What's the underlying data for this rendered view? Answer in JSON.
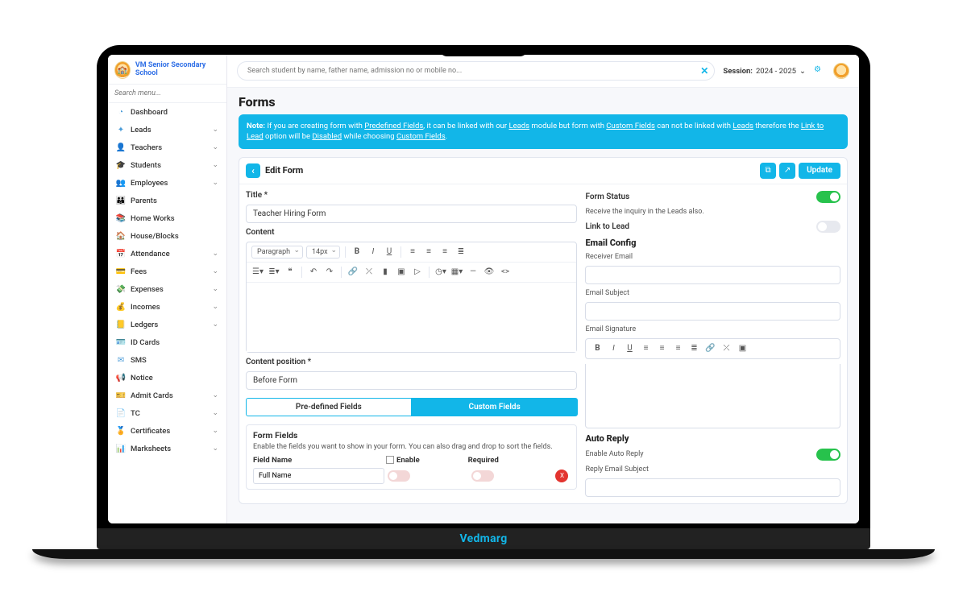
{
  "brand": {
    "name": "VM Senior Secondary School"
  },
  "searchMenuPlaceholder": "Search menu...",
  "menu": [
    {
      "icon": "◔",
      "label": "Dashboard",
      "expandable": false
    },
    {
      "icon": "✦",
      "label": "Leads",
      "expandable": true
    },
    {
      "icon": "👤",
      "label": "Teachers",
      "expandable": true
    },
    {
      "icon": "🎓",
      "label": "Students",
      "expandable": true
    },
    {
      "icon": "👥",
      "label": "Employees",
      "expandable": true
    },
    {
      "icon": "👪",
      "label": "Parents",
      "expandable": false
    },
    {
      "icon": "📚",
      "label": "Home Works",
      "expandable": false
    },
    {
      "icon": "🏠",
      "label": "House/Blocks",
      "expandable": false
    },
    {
      "icon": "📅",
      "label": "Attendance",
      "expandable": true
    },
    {
      "icon": "💳",
      "label": "Fees",
      "expandable": true
    },
    {
      "icon": "💸",
      "label": "Expenses",
      "expandable": true
    },
    {
      "icon": "💰",
      "label": "Incomes",
      "expandable": true
    },
    {
      "icon": "📒",
      "label": "Ledgers",
      "expandable": true
    },
    {
      "icon": "🪪",
      "label": "ID Cards",
      "expandable": false
    },
    {
      "icon": "✉",
      "label": "SMS",
      "expandable": false
    },
    {
      "icon": "📢",
      "label": "Notice",
      "expandable": false
    },
    {
      "icon": "🎫",
      "label": "Admit Cards",
      "expandable": true
    },
    {
      "icon": "📄",
      "label": "TC",
      "expandable": true
    },
    {
      "icon": "🏅",
      "label": "Certificates",
      "expandable": true
    },
    {
      "icon": "📊",
      "label": "Marksheets",
      "expandable": true
    }
  ],
  "topbar": {
    "searchPlaceholder": "Search student by name, father name, admission no or mobile no...",
    "sessionLabel": "Session:",
    "sessionValue": "2024 - 2025"
  },
  "page": {
    "title": "Forms"
  },
  "note": {
    "prefix": "Note:",
    "t1": "If you are creating form with",
    "predefined": "Predefined Fields",
    "t2": ", it can be linked with our",
    "leads1": "Leads",
    "t3": "module but form with",
    "custom1": "Custom Fields",
    "t4": "can not be linked with",
    "leads2": "Leads",
    "t5": "therefore the",
    "linkToLead": "Link to Lead",
    "t6": "option will be",
    "disabled": "Disabled",
    "t7": "while choosing",
    "custom2": "Custom Fields",
    "dot": "."
  },
  "card": {
    "title": "Edit Form",
    "updateLabel": "Update",
    "left": {
      "titleLabel": "Title *",
      "titleValue": "Teacher Hiring Form",
      "contentLabel": "Content",
      "paragraphSelect": "Paragraph",
      "fontSizeSelect": "14px",
      "contentPositionLabel": "Content position *",
      "contentPositionValue": "Before Form",
      "tabPredefined": "Pre-defined Fields",
      "tabCustom": "Custom Fields",
      "formFieldsTitle": "Form Fields",
      "formFieldsDesc": "Enable the fields you want to show in your form. You can also drag and drop to sort the fields.",
      "colFieldName": "Field Name",
      "colEnable": "Enable",
      "colRequired": "Required",
      "row1Name": "Full Name",
      "deleteSymbol": "X"
    },
    "right": {
      "formStatusLabel": "Form Status",
      "receiveText": "Receive the inquiry in the Leads also.",
      "linkToLeadLabel": "Link to Lead",
      "emailConfigTitle": "Email Config",
      "receiverEmailLabel": "Receiver Email",
      "emailSubjectLabel": "Email Subject",
      "emailSignatureLabel": "Email Signature",
      "autoReplyTitle": "Auto Reply",
      "enableAutoReplyLabel": "Enable Auto Reply",
      "replyEmailSubjectLabel": "Reply Email Subject"
    }
  },
  "footerBrand": "Vedmarg"
}
